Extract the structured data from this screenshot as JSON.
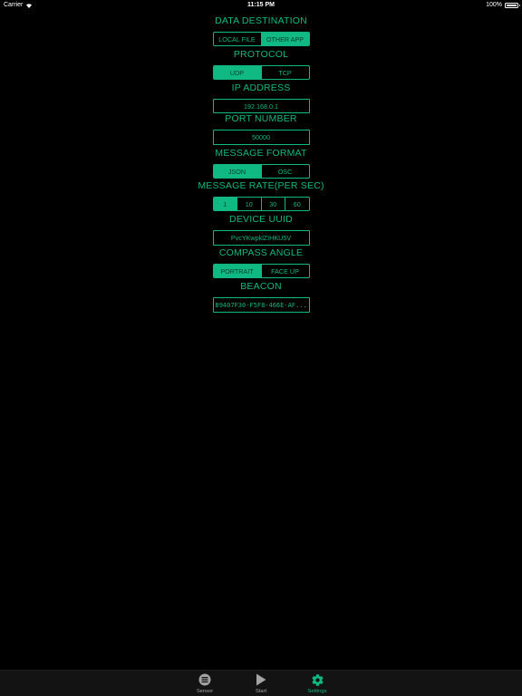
{
  "status_bar": {
    "carrier": "Carrier",
    "time": "11:15 PM",
    "battery": "100%"
  },
  "settings": {
    "data_destination": {
      "title": "DATA DESTINATION",
      "options": [
        "LOCAL FILE",
        "OTHER APP"
      ],
      "selected": "OTHER APP"
    },
    "protocol": {
      "title": "PROTOCOL",
      "options": [
        "UDP",
        "TCP"
      ],
      "selected": "UDP"
    },
    "ip_address": {
      "title": "IP ADDRESS",
      "value": "192.168.0.1"
    },
    "port_number": {
      "title": "PORT NUMBER",
      "value": "50000"
    },
    "message_format": {
      "title": "MESSAGE FORMAT",
      "options": [
        "JSON",
        "OSC"
      ],
      "selected": "JSON"
    },
    "message_rate": {
      "title": "MESSAGE RATE(PER SEC)",
      "options": [
        "1",
        "10",
        "30",
        "60"
      ],
      "selected": "1"
    },
    "device_uuid": {
      "title": "DEVICE UUID",
      "value": "PvcYKwpklZIHKU5V"
    },
    "compass_angle": {
      "title": "COMPASS ANGLE",
      "options": [
        "PORTRAIT",
        "FACE UP"
      ],
      "selected": "PORTRAIT"
    },
    "beacon": {
      "title": "BEACON",
      "value": "B9407F30-F5F8-466E-AF..."
    }
  },
  "tab_bar": {
    "tabs": [
      {
        "label": "Sensor",
        "icon": "sensor-list-icon",
        "active": false
      },
      {
        "label": "Start",
        "icon": "play-icon",
        "active": false
      },
      {
        "label": "Settings",
        "icon": "gear-icon",
        "active": true
      }
    ]
  },
  "colors": {
    "accent": "#10b981",
    "background": "#000000",
    "tab_bar_bg": "#131313",
    "inactive_tab": "#a3a3a3"
  }
}
